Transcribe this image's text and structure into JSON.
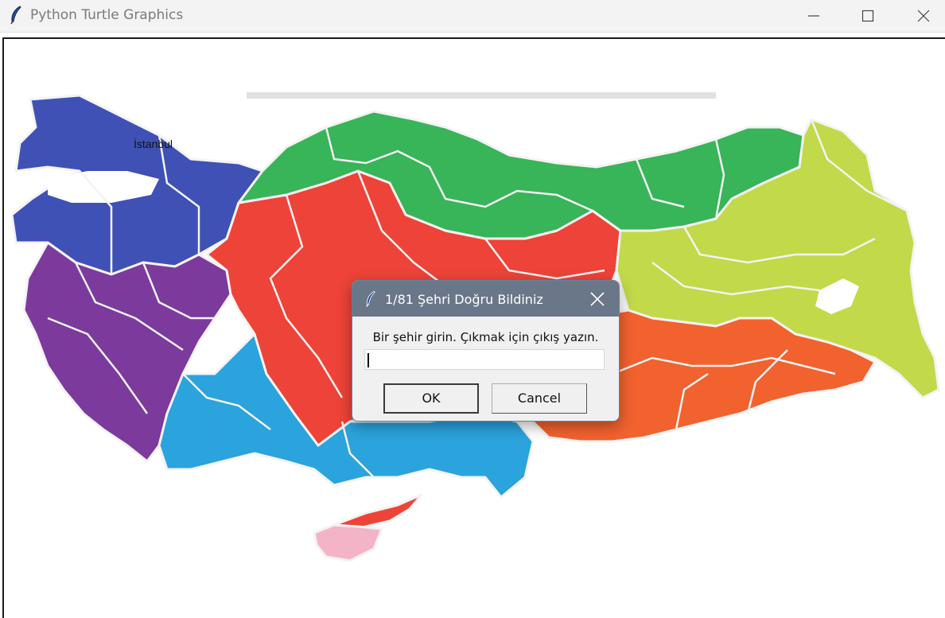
{
  "window": {
    "title": "Python Turtle Graphics",
    "icon": "feather-icon"
  },
  "map": {
    "city_label": "İstanbul",
    "region_colors": {
      "marmara": "#3f51b5",
      "aegean": "#7c3a9d",
      "mediterranean": "#2ba3dc",
      "central_anatolia": "#ee4338",
      "black_sea": "#38b459",
      "eastern_anatolia": "#c2d94a",
      "southeastern_anatolia": "#f2622e",
      "cyprus_north": "#ee4338",
      "cyprus_south": "#f4b4c8"
    }
  },
  "dialog": {
    "title": "1/81 Şehri Doğru Bildiniz",
    "prompt": "Bir şehir girin. Çıkmak için çıkış yazın.",
    "input_value": "",
    "ok_label": "OK",
    "cancel_label": "Cancel"
  }
}
